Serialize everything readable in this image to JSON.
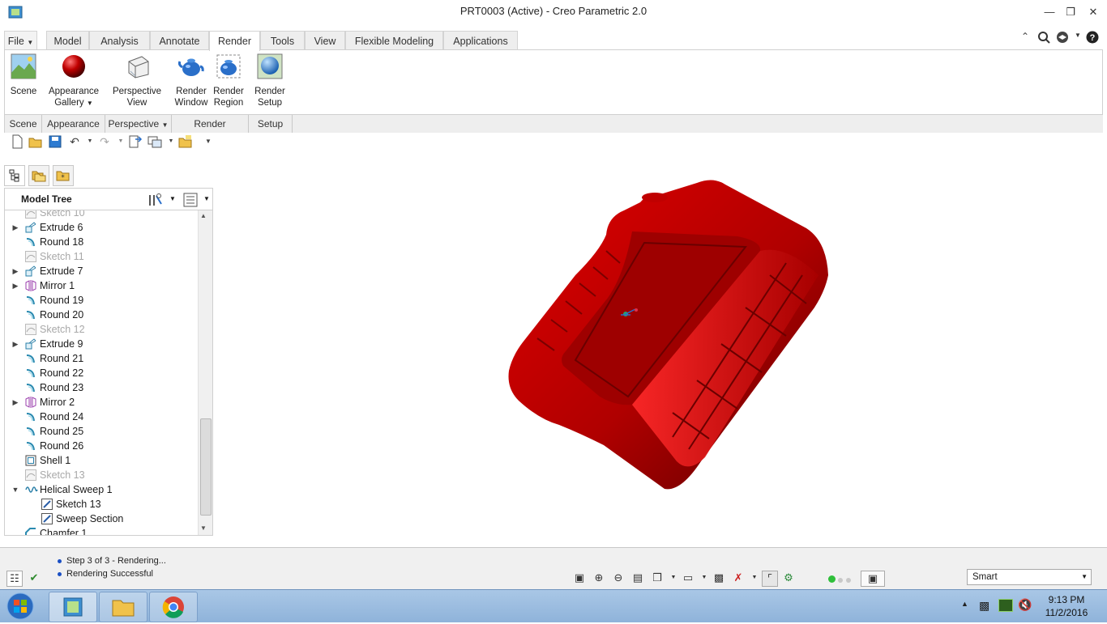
{
  "window": {
    "title": "PRT0003 (Active) - Creo Parametric 2.0"
  },
  "tabs": [
    {
      "label": "File"
    },
    {
      "label": "Model"
    },
    {
      "label": "Analysis"
    },
    {
      "label": "Annotate"
    },
    {
      "label": "Render"
    },
    {
      "label": "Tools"
    },
    {
      "label": "View"
    },
    {
      "label": "Flexible Modeling"
    },
    {
      "label": "Applications"
    }
  ],
  "active_tab": "Render",
  "ribbon": {
    "buttons": {
      "scene": "Scene",
      "appearance_line1": "Appearance",
      "appearance_line2": "Gallery",
      "perspective_line1": "Perspective",
      "perspective_line2": "View",
      "render_window_line1": "Render",
      "render_window_line2": "Window",
      "render_region_line1": "Render",
      "render_region_line2": "Region",
      "render_setup_line1": "Render",
      "render_setup_line2": "Setup"
    },
    "groups": {
      "scene": "Scene",
      "appearance": "Appearance",
      "perspective": "Perspective",
      "render": "Render",
      "setup": "Setup"
    }
  },
  "model_tree": {
    "header": "Model Tree",
    "items": [
      {
        "label": "Sketch 10",
        "expandable": false,
        "icon": "sketch-icon",
        "dim": true
      },
      {
        "label": "Extrude 6",
        "expandable": true,
        "icon": "extrude-icon",
        "dim": false
      },
      {
        "label": "Round 18",
        "expandable": false,
        "icon": "round-icon",
        "dim": false
      },
      {
        "label": "Sketch 11",
        "expandable": false,
        "icon": "sketch-icon",
        "dim": true
      },
      {
        "label": "Extrude 7",
        "expandable": true,
        "icon": "extrude-icon",
        "dim": false
      },
      {
        "label": "Mirror 1",
        "expandable": true,
        "icon": "mirror-icon",
        "dim": false
      },
      {
        "label": "Round 19",
        "expandable": false,
        "icon": "round-icon",
        "dim": false
      },
      {
        "label": "Round 20",
        "expandable": false,
        "icon": "round-icon",
        "dim": false
      },
      {
        "label": "Sketch 12",
        "expandable": false,
        "icon": "sketch-icon",
        "dim": true
      },
      {
        "label": "Extrude 9",
        "expandable": true,
        "icon": "extrude-icon",
        "dim": false
      },
      {
        "label": "Round 21",
        "expandable": false,
        "icon": "round-icon",
        "dim": false
      },
      {
        "label": "Round 22",
        "expandable": false,
        "icon": "round-icon",
        "dim": false
      },
      {
        "label": "Round 23",
        "expandable": false,
        "icon": "round-icon",
        "dim": false
      },
      {
        "label": "Mirror 2",
        "expandable": true,
        "icon": "mirror-icon",
        "dim": false
      },
      {
        "label": "Round 24",
        "expandable": false,
        "icon": "round-icon",
        "dim": false
      },
      {
        "label": "Round 25",
        "expandable": false,
        "icon": "round-icon",
        "dim": false
      },
      {
        "label": "Round 26",
        "expandable": false,
        "icon": "round-icon",
        "dim": false
      },
      {
        "label": "Shell 1",
        "expandable": false,
        "icon": "shell-icon",
        "dim": false
      },
      {
        "label": "Sketch 13",
        "expandable": false,
        "icon": "sketch-icon",
        "dim": true
      },
      {
        "label": "Helical Sweep 1",
        "expandable": true,
        "expanded": true,
        "icon": "helical-sweep-icon",
        "dim": false
      },
      {
        "label": "Sketch 13",
        "expandable": false,
        "icon": "sketch-edit-icon",
        "dim": false,
        "child": true
      },
      {
        "label": "Sweep Section",
        "expandable": false,
        "icon": "sketch-edit-icon",
        "dim": false,
        "child": true
      },
      {
        "label": "Chamfer 1",
        "expandable": false,
        "icon": "chamfer-icon",
        "dim": false
      }
    ]
  },
  "messages": [
    "Step 3 of 3 - Rendering...",
    "Rendering Successful"
  ],
  "selection_filter": {
    "value": "Smart"
  },
  "taskbar": {
    "time": "9:13 PM",
    "date": "11/2/2016"
  },
  "colors": {
    "model": "#cc0000",
    "ribbon_group_bg": "#eeeeee",
    "taskbar": "#9dbde0"
  }
}
